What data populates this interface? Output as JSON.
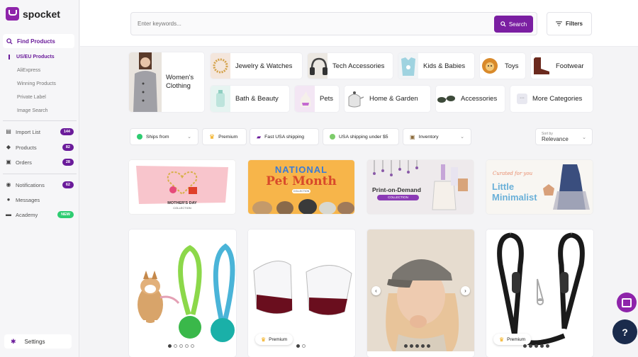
{
  "app": {
    "name": "spocket"
  },
  "sidebar": {
    "find_products": "Find Products",
    "sub_items": [
      "US/EU Products",
      "AliExpress",
      "Winning Products",
      "Private Label",
      "Image Search"
    ],
    "items": [
      {
        "label": "Import List",
        "badge": "144",
        "icon": "import-icon"
      },
      {
        "label": "Products",
        "badge": "82",
        "icon": "tag-icon"
      },
      {
        "label": "Orders",
        "badge": "28",
        "icon": "cart-icon"
      },
      {
        "label": "Notifications",
        "badge": "62",
        "icon": "bell-icon"
      },
      {
        "label": "Messages",
        "badge": "",
        "icon": "chat-icon"
      },
      {
        "label": "Academy",
        "badge": "NEW",
        "icon": "academy-icon"
      }
    ],
    "settings": "Settings"
  },
  "search": {
    "placeholder": "Enter keywords...",
    "button": "Search"
  },
  "filters_button": "Filters",
  "categories": {
    "womens": "Women's Clothing",
    "jewelry": "Jewelry & Watches",
    "tech": "Tech Accessories",
    "kids": "Kids & Babies",
    "toys": "Toys",
    "footwear": "Footwear",
    "bath": "Bath & Beauty",
    "pets": "Pets",
    "home": "Home & Garden",
    "accessories": "Accessories",
    "more": "More Categories"
  },
  "chips": {
    "ships_from": "Ships from",
    "premium": "Premium",
    "fast_usa": "Fast USA shipping",
    "usa_under": "USA shipping under $5",
    "inventory": "Inventory"
  },
  "sort": {
    "label": "Sort by",
    "value": "Relevance"
  },
  "banners": {
    "mothers_day": "MOTHER'S DAY",
    "mothers_day_sub": "COLLECTION",
    "pet_top": "NATIONAL",
    "pet_bottom": "Pet Month",
    "pet_sub": "COLLECTION",
    "pod_title": "Print-on-Demand",
    "pod_sub": "COLLECTION",
    "min_curated": "Curated for you",
    "min_title_1": "Little",
    "min_title_2": "Minimalist"
  },
  "product_badge": "Premium",
  "help": "?"
}
